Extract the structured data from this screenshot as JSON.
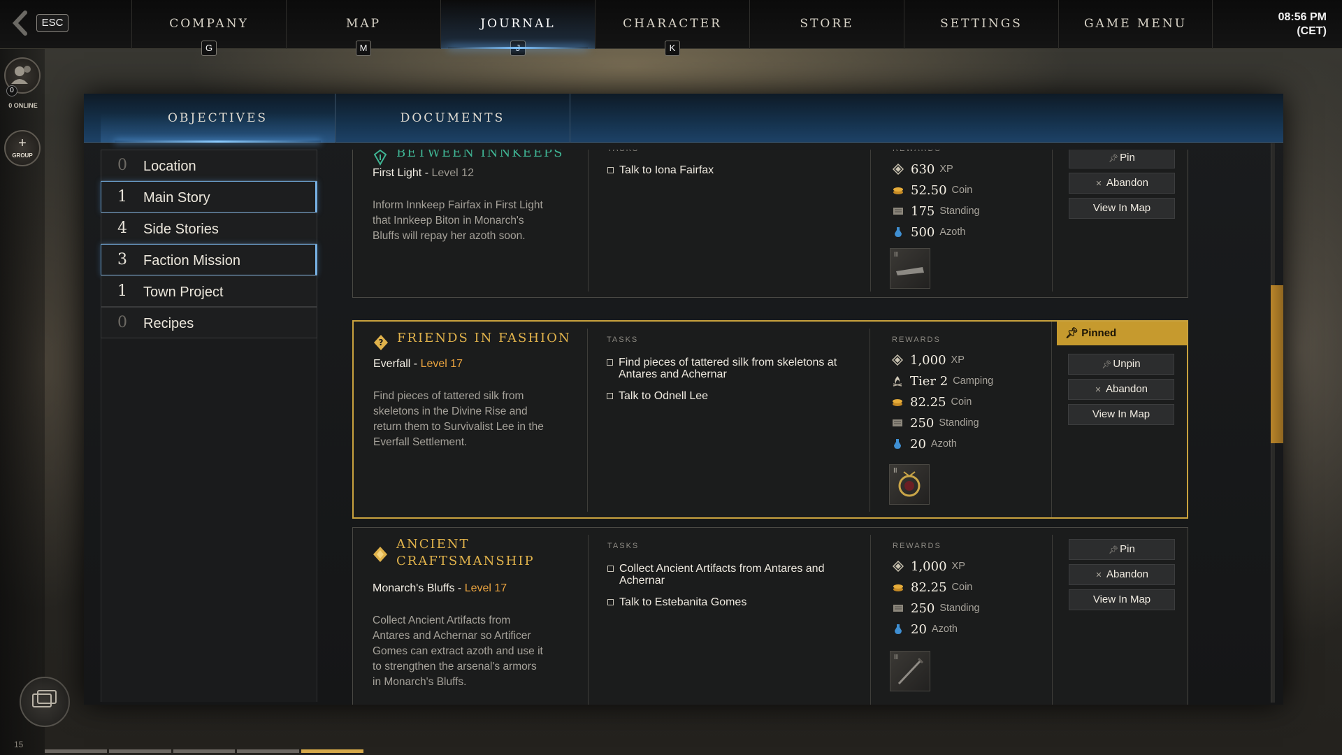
{
  "topbar": {
    "esc": "ESC",
    "tabs": [
      {
        "label": "COMPANY",
        "key": "G"
      },
      {
        "label": "MAP",
        "key": "M"
      },
      {
        "label": "JOURNAL",
        "key": "J",
        "active": true
      },
      {
        "label": "CHARACTER",
        "key": "K"
      },
      {
        "label": "STORE",
        "key": ""
      },
      {
        "label": "SETTINGS",
        "key": ""
      },
      {
        "label": "GAME MENU",
        "key": ""
      }
    ],
    "time": "08:56 PM",
    "timezone": "(CET)"
  },
  "social": {
    "online_count": "0",
    "online_label": "0 ONLINE",
    "group_label": "GROUP",
    "level": "15"
  },
  "journal": {
    "subtabs": [
      "OBJECTIVES",
      "DOCUMENTS"
    ],
    "categories": [
      {
        "count": "0",
        "name": "Location"
      },
      {
        "count": "1",
        "name": "Main Story"
      },
      {
        "count": "4",
        "name": "Side Stories"
      },
      {
        "count": "3",
        "name": "Faction Mission"
      },
      {
        "count": "1",
        "name": "Town Project"
      },
      {
        "count": "0",
        "name": "Recipes"
      }
    ],
    "labels": {
      "tasks": "TASKS",
      "rewards": "REWARDS"
    },
    "buttons": {
      "pin": "Pin",
      "unpin": "Unpin",
      "abandon": "Abandon",
      "view_map": "View In Map",
      "pinned": "Pinned"
    },
    "quests": [
      {
        "title": "BETWEEN INNKEEPS",
        "location": "First Light",
        "level": "Level 12",
        "description": "Inform Innkeep Fairfax in First Light that Innkeep Biton in Monarch's Bluffs will repay her azoth soon.",
        "tasks": [
          "Talk to Iona Fairfax"
        ],
        "rewards": [
          {
            "icon": "xp-icon",
            "value": "630",
            "label": "XP"
          },
          {
            "icon": "coin-icon",
            "value": "52.50",
            "label": "Coin"
          },
          {
            "icon": "standing-icon",
            "value": "175",
            "label": "Standing"
          },
          {
            "icon": "azoth-icon",
            "value": "500",
            "label": "Azoth"
          }
        ]
      },
      {
        "title": "FRIENDS IN FASHION",
        "location": "Everfall",
        "level": "Level 17",
        "description": "Find pieces of tattered silk from skeletons in the Divine Rise and return them to Survivalist Lee in the Everfall Settlement.",
        "tasks": [
          "Find pieces of tattered silk from skeletons at Antares and Achernar",
          "Talk to Odnell Lee"
        ],
        "rewards": [
          {
            "icon": "xp-icon",
            "value": "1,000",
            "label": "XP"
          },
          {
            "icon": "camping-icon",
            "value": "Tier 2",
            "label": "Camping"
          },
          {
            "icon": "coin-icon",
            "value": "82.25",
            "label": "Coin"
          },
          {
            "icon": "standing-icon",
            "value": "250",
            "label": "Standing"
          },
          {
            "icon": "azoth-icon",
            "value": "20",
            "label": "Azoth"
          }
        ]
      },
      {
        "title_line1": "ANCIENT",
        "title_line2": "CRAFTSMANSHIP",
        "location": "Monarch's Bluffs",
        "level": "Level 17",
        "description": "Collect Ancient Artifacts from Antares and Achernar so Artificer Gomes can extract azoth and use it to strengthen the arsenal's armors in Monarch's Bluffs.",
        "tasks": [
          "Collect Ancient Artifacts from Antares and Achernar",
          "Talk to Estebanita Gomes"
        ],
        "rewards": [
          {
            "icon": "xp-icon",
            "value": "1,000",
            "label": "XP"
          },
          {
            "icon": "coin-icon",
            "value": "82.25",
            "label": "Coin"
          },
          {
            "icon": "standing-icon",
            "value": "250",
            "label": "Standing"
          },
          {
            "icon": "azoth-icon",
            "value": "20",
            "label": "Azoth"
          }
        ]
      }
    ]
  },
  "colors": {
    "accent_gold": "#c69a2e",
    "accent_blue": "#7fc3ff",
    "teal_title": "#3fb594",
    "level_orange": "#e9a33f"
  }
}
